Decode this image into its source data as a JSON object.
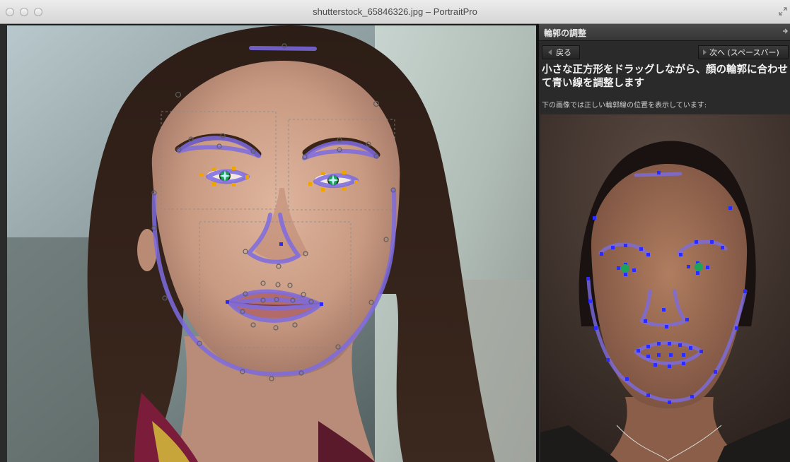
{
  "window": {
    "title": "shutterstock_65846326.jpg – PortraitPro"
  },
  "panel": {
    "header_title": "輪郭の調整",
    "back_label": "戻る",
    "next_label": "次へ (スペースバー)",
    "instruction": "小さな正方形をドラッグしながら、顔の輪郭に合わせて青い線を調整します",
    "sub_instruction": "下の画像では正しい輪郭線の位置を表示しています:"
  },
  "colors": {
    "outline": "#7d6be0",
    "handle_blue": "#2b2bff",
    "handle_orange": "#f0a400",
    "eye_green": "#1fa35a"
  }
}
